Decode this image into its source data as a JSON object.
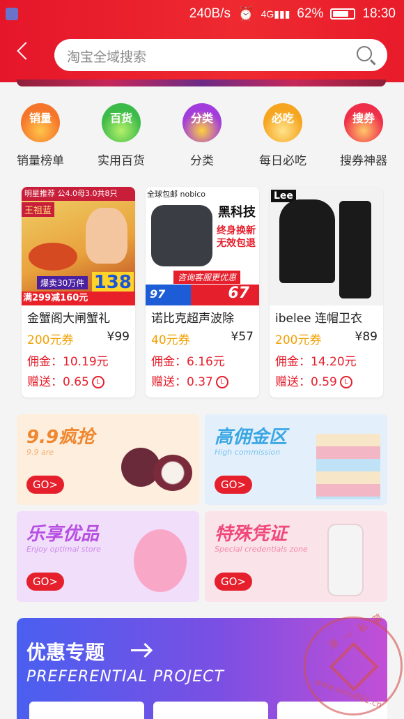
{
  "status_bar": {
    "net_speed": "240B/s",
    "battery": "62%",
    "time": "18:30"
  },
  "search": {
    "placeholder": "淘宝全域搜索"
  },
  "categories": [
    {
      "badge": "销量",
      "label": "销量榜单",
      "color": "#f5762a"
    },
    {
      "badge": "百货",
      "label": "实用百货",
      "color": "#3dbb4a"
    },
    {
      "badge": "分类",
      "label": "分类",
      "color": "#a23cdc"
    },
    {
      "badge": "必吃",
      "label": "每日必吃",
      "color": "#f5a51f"
    },
    {
      "badge": "搜券",
      "label": "搜券神器",
      "color": "#ef2f4a"
    }
  ],
  "products": [
    {
      "name": "金蟹阁大闸蟹礼",
      "coupon": "200元券",
      "price": "¥99",
      "commission": "佣金：10.19元",
      "gift": "赠送：0.65",
      "banner_top": "明星推荐 公4.0母3.0共8只",
      "banner_star": "王祖蓝",
      "banner_sale": "爆卖30万件",
      "banner_deal": "满299减160元",
      "banner_price": "138"
    },
    {
      "name": "诺比克超声波除",
      "coupon": "40元券",
      "price": "¥57",
      "commission": "佣金：6.16元",
      "gift": "赠送：0.37",
      "banner_top": "全球包邮 nobico",
      "banner_title": "黑科技",
      "banner_lines": [
        "终身换新",
        "无效包退"
      ],
      "banner_service": "咨询客服更优惠",
      "banner_old": "97",
      "banner_price": "67"
    },
    {
      "name": "ibelee 连帽卫衣",
      "coupon": "200元券",
      "price": "¥89",
      "commission": "佣金：14.20元",
      "gift": "赠送：0.59",
      "banner_brand": "Lee"
    }
  ],
  "tiles": [
    {
      "title": "9.9疯抢",
      "sub": "9.9 are",
      "go": "GO>",
      "bg": "#fdeedd",
      "color": "#f0862e"
    },
    {
      "title": "高佣金区",
      "sub": "High commission",
      "go": "GO>",
      "bg": "#e3f0fb",
      "color": "#3aa6e4"
    },
    {
      "title": "乐享优品",
      "sub": "Enjoy optimal store",
      "go": "GO>",
      "bg": "#f1defa",
      "color": "#b64fe2"
    },
    {
      "title": "特殊凭证",
      "sub": "Special credentials zone",
      "go": "GO>",
      "bg": "#fbe3ea",
      "color": "#f0487a"
    }
  ],
  "bottom": {
    "title": "优惠专题",
    "subtitle": "PREFERENTIAL PROJECT"
  },
  "watermark": {
    "text": "第一私募",
    "url": "www.simu001.cn"
  }
}
